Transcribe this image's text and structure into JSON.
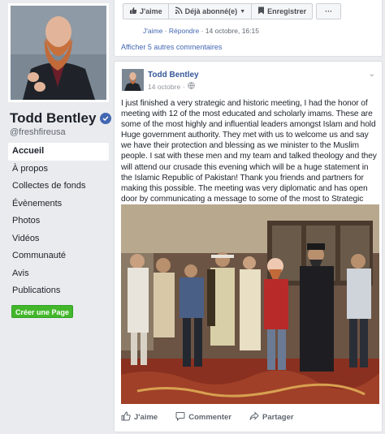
{
  "profile": {
    "name": "Todd Bentley",
    "handle": "@freshfireusa"
  },
  "sidebar": {
    "items": [
      {
        "label": "Accueil"
      },
      {
        "label": "À propos"
      },
      {
        "label": "Collectes de fonds"
      },
      {
        "label": "Évènements"
      },
      {
        "label": "Photos"
      },
      {
        "label": "Vidéos"
      },
      {
        "label": "Communauté"
      },
      {
        "label": "Avis"
      },
      {
        "label": "Publications"
      }
    ],
    "create_page_label": "Créer une Page"
  },
  "top_bar": {
    "like_label": "J'aime",
    "subscribed_label": "Déjà abonné(e)",
    "save_label": "Enregistrer",
    "more_label": "···"
  },
  "comment": {
    "like": "J'aime",
    "reply": "Répondre",
    "time": "14 octobre, 16:15"
  },
  "more_comments_label": "Afficher 5 autres commentaires",
  "post": {
    "author": "Todd Bentley",
    "date": "14 octobre",
    "text": "I just finished a very strategic and historic meeting, I had the honor of meeting with 12 of the most educated and scholarly imams. These are some of the most highly and influential leaders amongst Islam and hold Huge government authority. They met with us to welcome us and say we have their protection and blessing as we minister to the Muslim people. I sat with these men and my team and talked theology and they will attend our crusade this evening which will be a huge statement in the Islamic Republic of Pakistan! Thank you friends and partners for making this possible. The meeting was very diplomatic and has open door by communicating a message to some of the most to Strategic mosques we are welcome!",
    "actions": {
      "like": "J'aime",
      "comment": "Commenter",
      "share": "Partager"
    }
  },
  "colors": {
    "brand_blue": "#4267b2",
    "link_blue": "#365899",
    "green": "#42b72a",
    "page_bg": "#e9ebee"
  }
}
